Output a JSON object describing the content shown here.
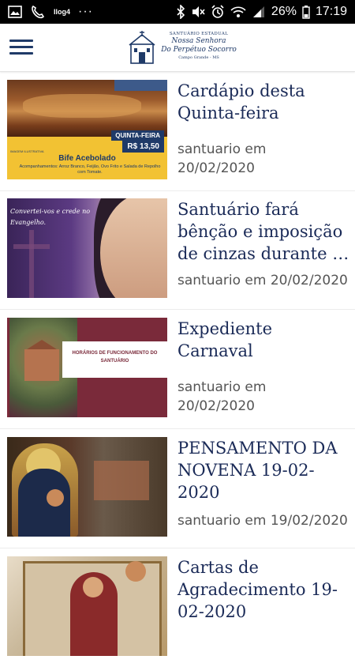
{
  "status_bar": {
    "left_icons": [
      "image-icon",
      "phone-icon",
      "volte-icon",
      "more-dots-icon"
    ],
    "volte_label": "Ilog4",
    "dots": "···",
    "right_icons": [
      "bluetooth-icon",
      "mute-icon",
      "alarm-icon",
      "wifi-icon",
      "signal-icon"
    ],
    "battery": "26%",
    "time": "17:19"
  },
  "header": {
    "menu_icon": "hamburger-menu-icon",
    "logo": {
      "line1": "SANTUÁRIO ESTADUAL",
      "line2": "Nossa Senhora",
      "line3": "Do Perpétuo Socorro",
      "line4": "Campo Grande - MS"
    }
  },
  "posts": [
    {
      "title": "Cardápio desta Quinta-feira",
      "author": "santuario",
      "date": "20/02/2020",
      "meta_line1": "santuario em",
      "meta_line2": "20/02/2020",
      "thumb": {
        "day": "QUINTA-FEIRA",
        "price": "R$ 13,50",
        "dish": "Bife Acebolado",
        "sides": "Acompanhamentos: Arroz Branco, Feijão, Ovo Frito e Salada de Repolho com Tomate.",
        "note": "IMAGEM ILUSTRATIVA"
      }
    },
    {
      "title": "Santuário fará bênção e imposição de cinzas durante a Quarta-feira de Cinzas",
      "meta_line1": "santuario em 20/02/2020",
      "thumb": {
        "quote": "Convertei-vos e crede no Evangelho."
      }
    },
    {
      "title": "Expediente Carnaval",
      "meta_line1": "santuario em",
      "meta_line2": "20/02/2020",
      "thumb": {
        "band": "HORÁRIOS DE FUNCIONAMENTO DO SANTUÁRIO"
      }
    },
    {
      "title": "PENSAMENTO DA NOVENA 19-02-2020",
      "meta_line1": "santuario em 19/02/2020"
    },
    {
      "title": "Cartas de Agradecimento 19-02-2020"
    }
  ],
  "colors": {
    "title": "#1a2a57",
    "meta": "#555555",
    "accent": "#1f3a68"
  }
}
